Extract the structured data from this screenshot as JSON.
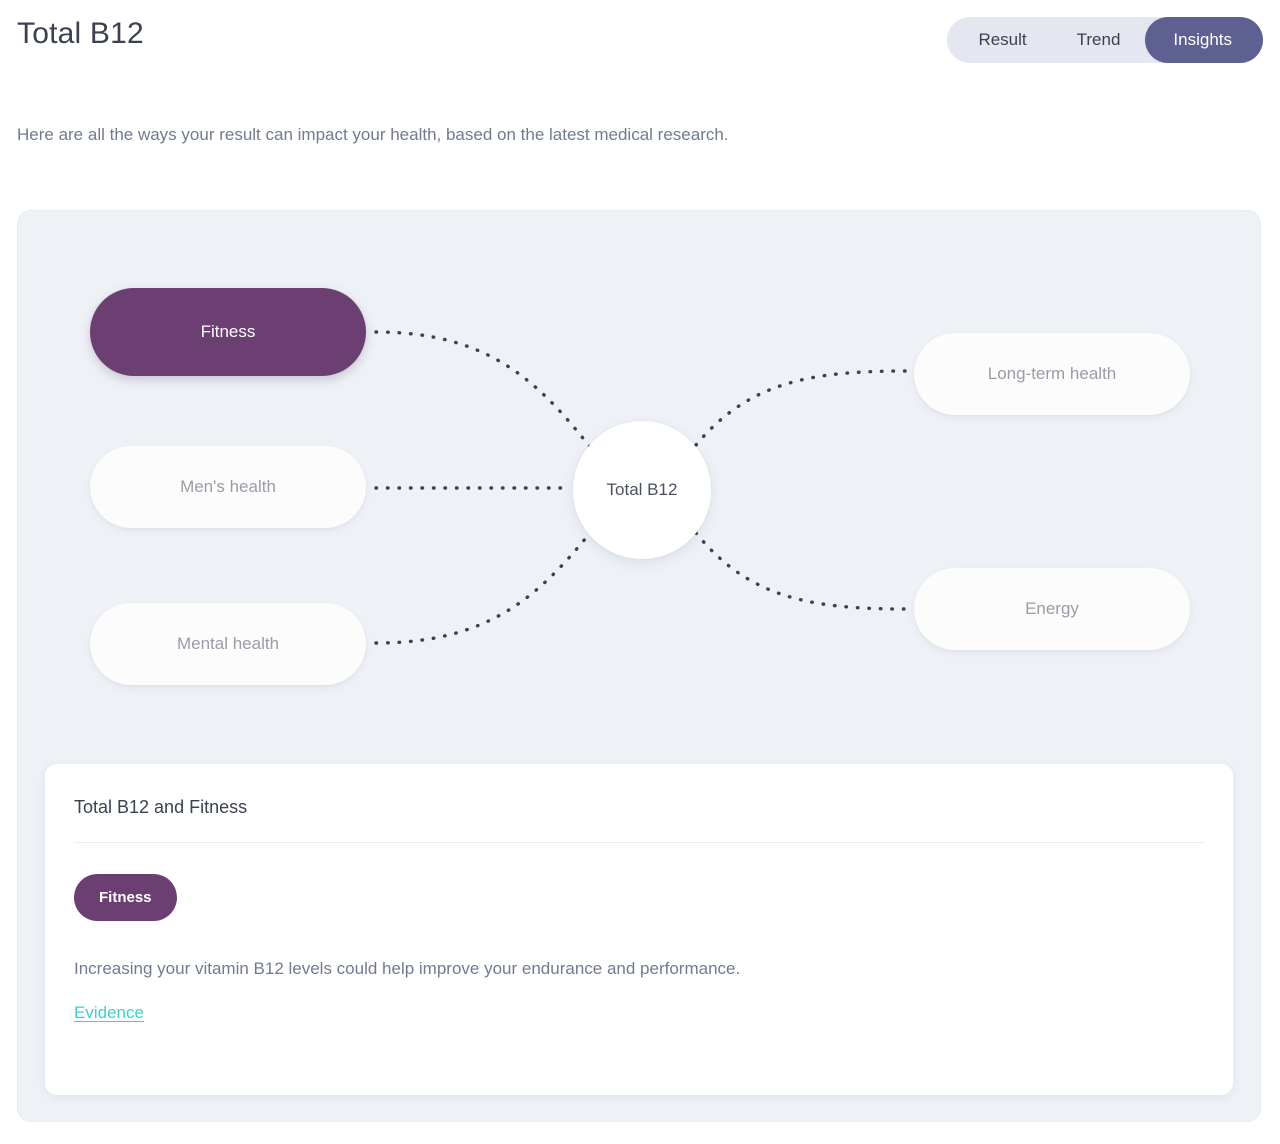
{
  "header": {
    "title": "Total B12",
    "tabs": [
      {
        "label": "Result",
        "active": false
      },
      {
        "label": "Trend",
        "active": false
      },
      {
        "label": "Insights",
        "active": true
      }
    ]
  },
  "intro": "Here are all the ways your result can impact your health, based on the latest medical research.",
  "diagram": {
    "center_node": "Total B12",
    "left_nodes": [
      {
        "label": "Fitness",
        "selected": true
      },
      {
        "label": "Men's health",
        "selected": false
      },
      {
        "label": "Mental health",
        "selected": false
      }
    ],
    "right_nodes": [
      {
        "label": "Long-term health",
        "selected": false
      },
      {
        "label": "Energy",
        "selected": false
      }
    ]
  },
  "detail": {
    "title": "Total B12 and Fitness",
    "badge": "Fitness",
    "body": "Increasing your vitamin B12 levels could help improve your endurance and performance.",
    "link": "Evidence"
  },
  "colors": {
    "accent_purple": "#6b3f72",
    "active_tab": "#5d6090",
    "panel_bg": "#eef1f6",
    "link_teal": "#3fd0c9",
    "connector": "#3a4152"
  }
}
